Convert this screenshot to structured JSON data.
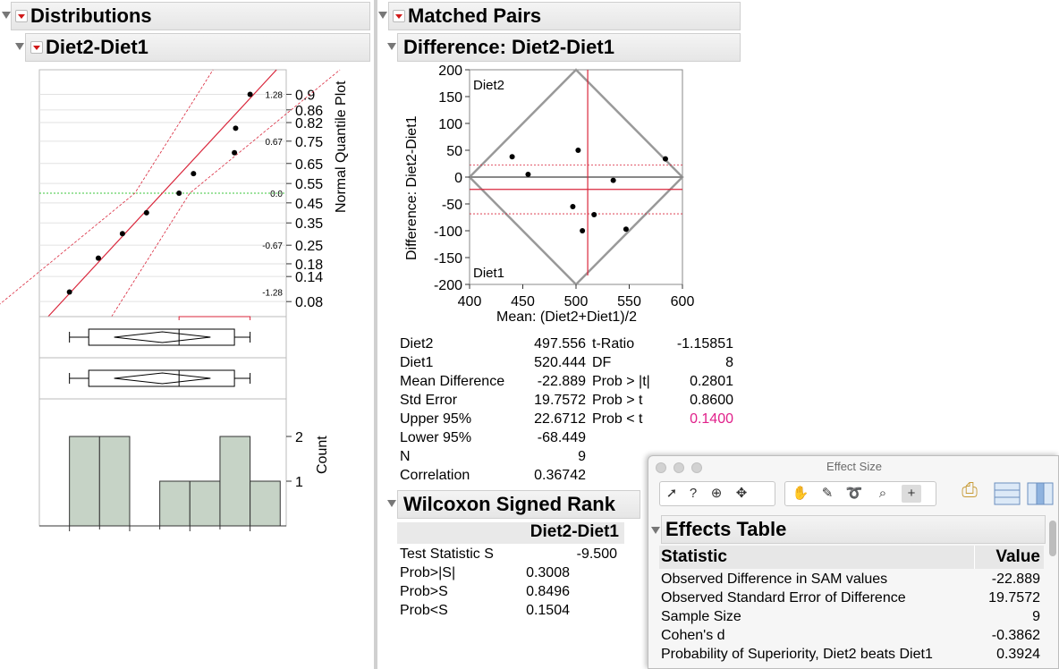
{
  "left": {
    "header": "Distributions",
    "sub_header": "Diet2-Diet1",
    "quantile_axis_title": "Normal Quantile Plot",
    "count_axis_title": "Count",
    "quantile_ticks": [
      "0.9",
      "0.86",
      "0.82",
      "0.75",
      "0.65",
      "0.55",
      "0.45",
      "0.35",
      "0.25",
      "0.18",
      "0.14",
      "0.08"
    ],
    "z_labels": [
      "1.28",
      "0.67",
      "0.0",
      "-0.67",
      "-1.28"
    ],
    "count_ticks": [
      "2",
      "1"
    ],
    "x_ticks": [
      "-100",
      "-50",
      "0",
      "50"
    ],
    "values": [
      -100,
      -76,
      -56,
      -36,
      -9,
      3,
      37,
      38,
      50
    ],
    "histogram": [
      {
        "from": -100,
        "to": -75,
        "count": 2
      },
      {
        "from": -75,
        "to": -50,
        "count": 2
      },
      {
        "from": -25,
        "to": 0,
        "count": 1
      },
      {
        "from": 0,
        "to": 25,
        "count": 1
      },
      {
        "from": 25,
        "to": 50,
        "count": 2
      },
      {
        "from": 50,
        "to": 75,
        "count": 1
      }
    ],
    "box": {
      "min": -100,
      "q1": -84,
      "median": -9,
      "q3": 37,
      "max": 50,
      "mean": -22.889
    }
  },
  "right": {
    "header": "Matched Pairs",
    "sub_header": "Difference: Diet2-Diet1",
    "plot": {
      "y_title": "Difference: Diet2-Diet1",
      "x_title": "Mean: (Diet2+Diet1)/2",
      "top_label": "Diet2",
      "bottom_label": "Diet1",
      "y_ticks": [
        "200",
        "150",
        "100",
        "50",
        "0",
        "-50",
        "-100",
        "-150",
        "-200"
      ],
      "x_ticks": [
        "400",
        "450",
        "500",
        "550",
        "600"
      ]
    },
    "stats_left": [
      {
        "label": "Diet2",
        "value": "497.556"
      },
      {
        "label": "Diet1",
        "value": "520.444"
      },
      {
        "label": "Mean Difference",
        "value": "-22.889"
      },
      {
        "label": "Std Error",
        "value": "19.7572"
      },
      {
        "label": "Upper 95%",
        "value": "22.6712"
      },
      {
        "label": "Lower 95%",
        "value": "-68.449"
      },
      {
        "label": "N",
        "value": "9"
      },
      {
        "label": "Correlation",
        "value": "0.36742"
      }
    ],
    "stats_right": [
      {
        "label": "t-Ratio",
        "value": "-1.15851"
      },
      {
        "label": "DF",
        "value": "8"
      },
      {
        "label": "Prob > |t|",
        "value": "0.2801"
      },
      {
        "label": "Prob > t",
        "value": "0.8600"
      },
      {
        "label": "Prob < t",
        "value": "0.1400"
      }
    ],
    "highlight_color": "#e0208a",
    "wilcoxon": {
      "header": "Wilcoxon Signed Rank",
      "column": "Diet2-Diet1",
      "rows": [
        {
          "label": "Test Statistic S",
          "value": "-9.500"
        },
        {
          "label": "Prob>|S|",
          "value": "0.3008"
        },
        {
          "label": "Prob>S",
          "value": "0.8496"
        },
        {
          "label": "Prob<S",
          "value": "0.1504"
        }
      ]
    }
  },
  "effect_window": {
    "title": "Effect Size",
    "toolbar_icons": [
      "arrow-icon",
      "help-icon",
      "selection-icon",
      "move-icon",
      "hand-icon",
      "brush-icon",
      "lasso-icon",
      "magnifier-icon",
      "crosshair-icon",
      "save-script-icon",
      "grid-icon",
      "column-icon"
    ],
    "table_header": "Effects Table",
    "col_statistic": "Statistic",
    "col_value": "Value",
    "rows": [
      {
        "label": "Observed Difference in SAM values",
        "value": "-22.889"
      },
      {
        "label": "Observed Standard Error of Difference",
        "value": "19.7572"
      },
      {
        "label": "Sample Size",
        "value": "9"
      },
      {
        "label": "Cohen's d",
        "value": "-0.3862"
      },
      {
        "label": "Probability of Superiority, Diet2 beats Diet1",
        "value": "0.3924"
      }
    ]
  }
}
